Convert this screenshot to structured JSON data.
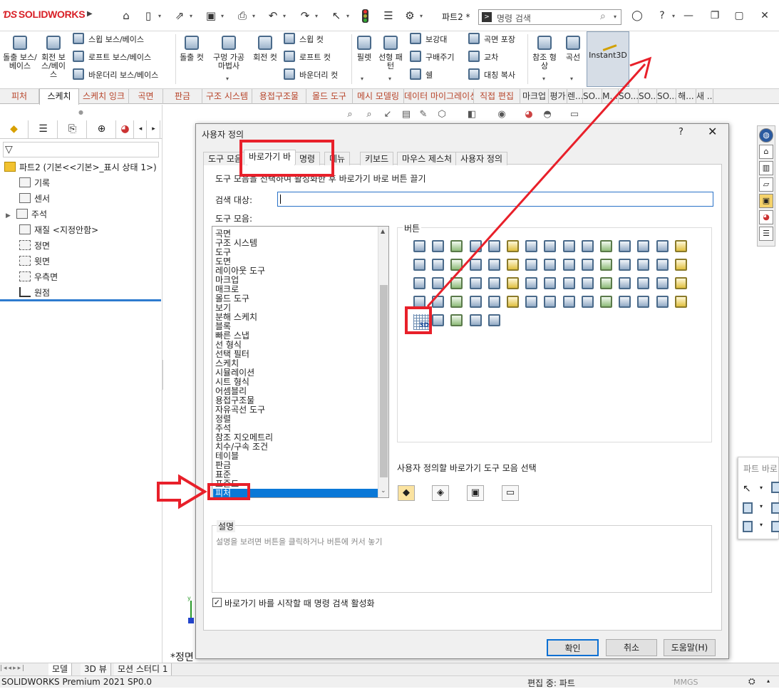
{
  "app": {
    "logo": "SOLIDWORKS",
    "doc_title": "파트2 *",
    "command_search_placeholder": "명령 검색"
  },
  "ribbon": {
    "extrude_boss": "돌출 보스/베이스",
    "revolve_boss": "회전 보스/베이스",
    "sweep_boss": "스윕 보스/베이스",
    "loft_boss": "로프트 보스/베이스",
    "boundary_boss": "바운더리 보스/베이스",
    "extrude_cut": "돌출 컷",
    "hole_wizard": "구멍 가공 마법사",
    "revolve_cut": "회전 컷",
    "sweep_cut": "스윕 컷",
    "loft_cut": "로프트 컷",
    "boundary_cut": "바운더리 컷",
    "fillet": "필렛",
    "linear_pattern": "선형 패턴",
    "rib": "보강대",
    "draft": "구배주기",
    "shell": "쉘",
    "wrap": "곡면 포장",
    "intersect": "교차",
    "mirror": "대칭 복사",
    "ref_geometry": "참조 형상",
    "curves": "곡선",
    "instant3d": "Instant3D"
  },
  "tabs": [
    "피처",
    "스케치",
    "스케치 잉크",
    "곡면",
    "판금",
    "구조 시스템",
    "용접구조물",
    "몰드 도구",
    "메시 모델링",
    "데이터 마이그레이션",
    "직접 편집",
    "마크업",
    "평가",
    "렌...",
    "SO...",
    "M...",
    "SO...",
    "SO...",
    "SO...",
    "해...",
    "새 ..."
  ],
  "feature_tree": {
    "part": "파트2  (기본<<기본>_표시 상태 1>)",
    "items": [
      "기록",
      "센서",
      "주석",
      "재질 <지정안함>",
      "정면",
      "윗면",
      "우측면",
      "원점"
    ]
  },
  "dialog": {
    "title": "사용자 정의",
    "help_q": "?",
    "tabs": [
      "도구 모음",
      "바로가기 바",
      "명령",
      "메뉴",
      "키보드",
      "마우스 제스처",
      "사용자 정의"
    ],
    "instruction": "도구 모음을 선택하여 활성화한 후 바로가기 바로 버튼 끌기",
    "search_label": "검색 대상:",
    "toolbars_label": "도구 모음:",
    "toolbar_list": [
      "곡면",
      "구조 시스템",
      "도구",
      "도면",
      "레이아웃 도구",
      "마크업",
      "매크로",
      "몰드 도구",
      "보기",
      "분해 스케치",
      "블록",
      "빠른 스냅",
      "선 형식",
      "선택 필터",
      "스케치",
      "시뮬레이션",
      "시트 형식",
      "어셈블리",
      "용접구조물",
      "자유곡선 도구",
      "정렬",
      "주석",
      "참조 지오메트리",
      "치수/구속 조건",
      "테이블",
      "판금",
      "표준",
      "표준도",
      "피처"
    ],
    "selected_toolbar": "피처",
    "buttons_label": "버튼",
    "shortcut_label": "사용자 정의할 바로가기 도구 모음 선택",
    "description_label": "설명",
    "description_text": "설명을 보려면 버튼을 클릭하거나 버튼에 커서 놓기",
    "checkbox_label": "바로가기 바를 시작할 때 명령 검색 활성화",
    "checkbox_checked": "✓",
    "ok": "확인",
    "cancel": "취소",
    "help": "도움말(H)"
  },
  "partbar_title": "파트 바로",
  "view_label": "*정면",
  "bottom_tabs": [
    "모델",
    "3D 뷰",
    "모션 스터디 1"
  ],
  "status": {
    "version": "SOLIDWORKS Premium 2021 SP0.0",
    "editing": "편집 중: 파트",
    "units": "MMGS"
  },
  "annotation_color": "#e8202a"
}
